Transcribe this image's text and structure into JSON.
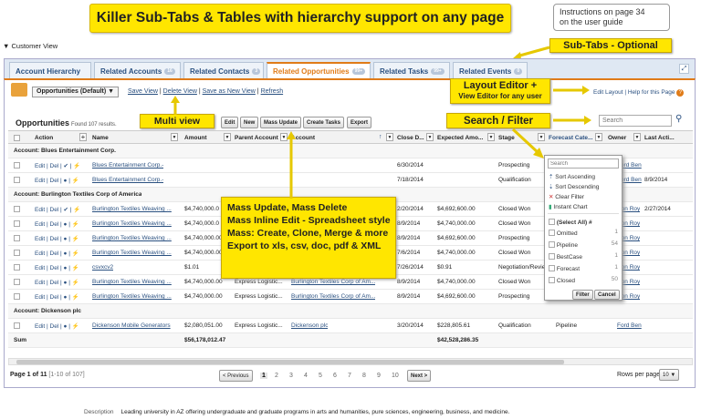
{
  "banner": "Killer Sub-Tabs & Tables with hierarchy support on any page",
  "instructions": [
    "Instructions on page 34",
    "on the user guide"
  ],
  "section_title": "▼ Customer View",
  "callouts": {
    "subtabs": "Sub-Tabs - Optional",
    "layout1": "Layout  Editor +",
    "layout2": "View Editor for any user",
    "multiview": "Multi view",
    "search": "Search / Filter"
  },
  "tabs": [
    {
      "label": "Account Hierarchy",
      "badge": ""
    },
    {
      "label": "Related Accounts",
      "badge": "16"
    },
    {
      "label": "Related Contacts",
      "badge": "3"
    },
    {
      "label": "Related Opportunities",
      "badge": "99+"
    },
    {
      "label": "Related Tasks",
      "badge": "99+"
    },
    {
      "label": "Related Events",
      "badge": "0"
    }
  ],
  "view_select": "Opportunities (Default) ▼",
  "view_links": [
    "Save View",
    "Delete View",
    "Save as New View",
    "Refresh"
  ],
  "top_right_links": [
    "Edit Layout",
    "Help for this Page"
  ],
  "list_title": "Opportunities",
  "found": "Found 107 results.",
  "buttons": [
    "Edit",
    "New",
    "Mass Update",
    "Create Tasks",
    "Export"
  ],
  "search_placeholder": "Search",
  "columns": [
    "Action",
    "Name",
    "Amount",
    "Parent Account",
    "Account",
    "Close D...",
    "Expected Amo...",
    "Stage",
    "Forecast Cate...",
    "Owner",
    "Last Acti..."
  ],
  "groups": [
    "Account: Blues Entertainment Corp.",
    "Account: Burlington Textiles Corp of America",
    "Account: Dickenson plc"
  ],
  "rows": [
    {
      "action": "Edit | Del | ✔ | ⚡",
      "name": "Blues Entertainment Corp.-",
      "amount": "",
      "parent": "",
      "account": "",
      "close": "6/30/2014",
      "expected": "",
      "stage": "Prospecting",
      "forecast": "",
      "owner": "Ford Ben",
      "last": ""
    },
    {
      "action": "Edit | Del | ● | ⚡",
      "name": "Blues Entertainment Corp.-",
      "amount": "",
      "parent": "",
      "account": "",
      "close": "7/18/2014",
      "expected": "",
      "stage": "Qualification",
      "forecast": "",
      "owner": "Ford Ben",
      "last": "8/9/2014"
    },
    {
      "action": "Edit | Del | ✔ | ⚡",
      "name": "Burlington Textiles Weaving ...",
      "amount": "$4,740,000.0",
      "parent": "",
      "account": "",
      "close": "2/20/2014",
      "expected": "$4,692,600.00",
      "stage": "Closed Won",
      "forecast": "",
      "owner": "Ron Roy",
      "last": "2/27/2014"
    },
    {
      "action": "Edit | Del | ● | ⚡",
      "name": "Burlington Textiles Weaving ...",
      "amount": "$4,740,000.0",
      "parent": "",
      "account": "",
      "close": "8/9/2014",
      "expected": "$4,740,000.00",
      "stage": "Closed Won",
      "forecast": "",
      "owner": "Ron Roy",
      "last": ""
    },
    {
      "action": "Edit | Del | ● | ⚡",
      "name": "Burlington Textiles Weaving ...",
      "amount": "$4,740,000.00",
      "parent": "Express Logistic...",
      "account": "Burlington Textiles Corp of Am...",
      "close": "8/9/2014",
      "expected": "$4,692,600.00",
      "stage": "Prospecting",
      "forecast": "",
      "owner": "Ron Roy",
      "last": ""
    },
    {
      "action": "Edit | Del | ● | ⚡",
      "name": "Burlington Textiles Weaving ...",
      "amount": "$4,740,000.00",
      "parent": "Express Logistic...",
      "account": "Burlington Textiles Corp of Am...",
      "close": "7/6/2014",
      "expected": "$4,740,000.00",
      "stage": "Closed Won",
      "forecast": "",
      "owner": "Ron Roy",
      "last": ""
    },
    {
      "action": "Edit | Del | ● | ⚡",
      "name": "csvxcv2",
      "amount": "$1.01",
      "parent": "Express Logistic...",
      "account": "Burlington Textiles Corp of Am...",
      "close": "7/26/2014",
      "expected": "$0.91",
      "stage": "Negotiation/Review",
      "forecast": "",
      "owner": "Ron Roy",
      "last": ""
    },
    {
      "action": "Edit | Del | ● | ⚡",
      "name": "Burlington Textiles Weaving ...",
      "amount": "$4,740,000.00",
      "parent": "Express Logistic...",
      "account": "Burlington Textiles Corp of Am...",
      "close": "8/9/2014",
      "expected": "$4,740,000.00",
      "stage": "Closed Won",
      "forecast": "",
      "owner": "Ron Roy",
      "last": ""
    },
    {
      "action": "Edit | Del | ● | ⚡",
      "name": "Burlington Textiles Weaving ...",
      "amount": "$4,740,000.00",
      "parent": "Express Logistic...",
      "account": "Burlington Textiles Corp of Am...",
      "close": "8/9/2014",
      "expected": "$4,692,600.00",
      "stage": "Prospecting",
      "forecast": "Pipeline",
      "owner": "Ron Roy",
      "last": ""
    },
    {
      "action": "Edit | Del | ● | ⚡",
      "name": "Dickenson Mobile Generators",
      "amount": "$2,080,051.00",
      "parent": "Express Logistic...",
      "account": "Dickenson plc",
      "close": "3/20/2014",
      "expected": "$228,805.61",
      "stage": "Qualification",
      "forecast": "Pipeline",
      "owner": "Ford Ben",
      "last": ""
    }
  ],
  "sum": {
    "label": "Sum",
    "amount": "$56,178,012.47",
    "expected": "$42,528,286.35"
  },
  "mass_lines": [
    "Mass Update, Mass Delete",
    "Mass Inline Edit - Spreadsheet style",
    "Mass: Create, Clone, Merge & more",
    "Export to xls, csv, doc, pdf & XML"
  ],
  "menu": {
    "search": "Search",
    "items": [
      "Sort Ascending",
      "Sort Descending",
      "Clear Filter",
      "Instant Chart"
    ],
    "select_all": "(Select All) #",
    "filters": [
      {
        "label": "Omitted",
        "count": "1"
      },
      {
        "label": "Pipeline",
        "count": "54"
      },
      {
        "label": "BestCase",
        "count": "1"
      },
      {
        "label": "Forecast",
        "count": "1"
      },
      {
        "label": "Closed",
        "count": "50"
      }
    ],
    "filter_btn": "Filter",
    "cancel_btn": "Cancel"
  },
  "pagination": {
    "page": "Page 1 of 11",
    "range": "[1-10 of 107]",
    "prev": "< Previous",
    "pages": [
      "1",
      "2",
      "3",
      "4",
      "5",
      "6",
      "7",
      "8",
      "9",
      "10"
    ],
    "next": "Next >",
    "rows_label": "Rows per page",
    "rows_value": "10 ▼"
  },
  "description": {
    "label": "Description",
    "text": "Leading university in AZ offering undergraduate and graduate programs in arts and humanities, pure sciences, engineering, business, and medicine."
  },
  "colors": {
    "accent": "#e07b18",
    "callout": "#ffe600",
    "link": "#2a5080"
  }
}
